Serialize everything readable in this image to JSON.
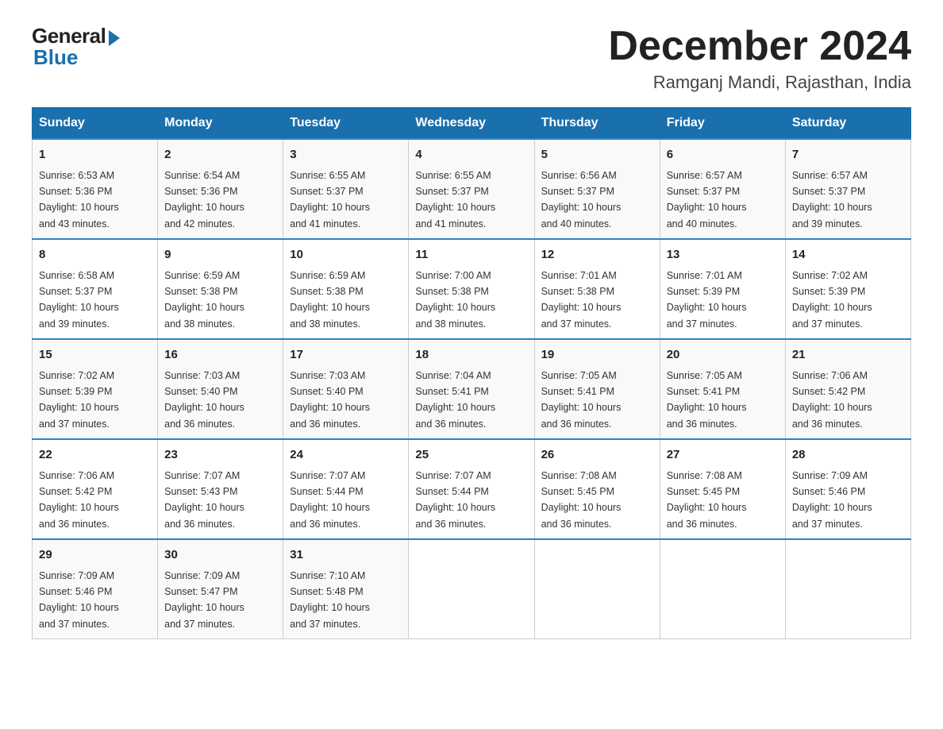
{
  "header": {
    "logo_general": "General",
    "logo_blue": "Blue",
    "title": "December 2024",
    "subtitle": "Ramganj Mandi, Rajasthan, India"
  },
  "weekdays": [
    "Sunday",
    "Monday",
    "Tuesday",
    "Wednesday",
    "Thursday",
    "Friday",
    "Saturday"
  ],
  "weeks": [
    [
      {
        "day": "1",
        "sunrise": "6:53 AM",
        "sunset": "5:36 PM",
        "daylight": "10 hours and 43 minutes."
      },
      {
        "day": "2",
        "sunrise": "6:54 AM",
        "sunset": "5:36 PM",
        "daylight": "10 hours and 42 minutes."
      },
      {
        "day": "3",
        "sunrise": "6:55 AM",
        "sunset": "5:37 PM",
        "daylight": "10 hours and 41 minutes."
      },
      {
        "day": "4",
        "sunrise": "6:55 AM",
        "sunset": "5:37 PM",
        "daylight": "10 hours and 41 minutes."
      },
      {
        "day": "5",
        "sunrise": "6:56 AM",
        "sunset": "5:37 PM",
        "daylight": "10 hours and 40 minutes."
      },
      {
        "day": "6",
        "sunrise": "6:57 AM",
        "sunset": "5:37 PM",
        "daylight": "10 hours and 40 minutes."
      },
      {
        "day": "7",
        "sunrise": "6:57 AM",
        "sunset": "5:37 PM",
        "daylight": "10 hours and 39 minutes."
      }
    ],
    [
      {
        "day": "8",
        "sunrise": "6:58 AM",
        "sunset": "5:37 PM",
        "daylight": "10 hours and 39 minutes."
      },
      {
        "day": "9",
        "sunrise": "6:59 AM",
        "sunset": "5:38 PM",
        "daylight": "10 hours and 38 minutes."
      },
      {
        "day": "10",
        "sunrise": "6:59 AM",
        "sunset": "5:38 PM",
        "daylight": "10 hours and 38 minutes."
      },
      {
        "day": "11",
        "sunrise": "7:00 AM",
        "sunset": "5:38 PM",
        "daylight": "10 hours and 38 minutes."
      },
      {
        "day": "12",
        "sunrise": "7:01 AM",
        "sunset": "5:38 PM",
        "daylight": "10 hours and 37 minutes."
      },
      {
        "day": "13",
        "sunrise": "7:01 AM",
        "sunset": "5:39 PM",
        "daylight": "10 hours and 37 minutes."
      },
      {
        "day": "14",
        "sunrise": "7:02 AM",
        "sunset": "5:39 PM",
        "daylight": "10 hours and 37 minutes."
      }
    ],
    [
      {
        "day": "15",
        "sunrise": "7:02 AM",
        "sunset": "5:39 PM",
        "daylight": "10 hours and 37 minutes."
      },
      {
        "day": "16",
        "sunrise": "7:03 AM",
        "sunset": "5:40 PM",
        "daylight": "10 hours and 36 minutes."
      },
      {
        "day": "17",
        "sunrise": "7:03 AM",
        "sunset": "5:40 PM",
        "daylight": "10 hours and 36 minutes."
      },
      {
        "day": "18",
        "sunrise": "7:04 AM",
        "sunset": "5:41 PM",
        "daylight": "10 hours and 36 minutes."
      },
      {
        "day": "19",
        "sunrise": "7:05 AM",
        "sunset": "5:41 PM",
        "daylight": "10 hours and 36 minutes."
      },
      {
        "day": "20",
        "sunrise": "7:05 AM",
        "sunset": "5:41 PM",
        "daylight": "10 hours and 36 minutes."
      },
      {
        "day": "21",
        "sunrise": "7:06 AM",
        "sunset": "5:42 PM",
        "daylight": "10 hours and 36 minutes."
      }
    ],
    [
      {
        "day": "22",
        "sunrise": "7:06 AM",
        "sunset": "5:42 PM",
        "daylight": "10 hours and 36 minutes."
      },
      {
        "day": "23",
        "sunrise": "7:07 AM",
        "sunset": "5:43 PM",
        "daylight": "10 hours and 36 minutes."
      },
      {
        "day": "24",
        "sunrise": "7:07 AM",
        "sunset": "5:44 PM",
        "daylight": "10 hours and 36 minutes."
      },
      {
        "day": "25",
        "sunrise": "7:07 AM",
        "sunset": "5:44 PM",
        "daylight": "10 hours and 36 minutes."
      },
      {
        "day": "26",
        "sunrise": "7:08 AM",
        "sunset": "5:45 PM",
        "daylight": "10 hours and 36 minutes."
      },
      {
        "day": "27",
        "sunrise": "7:08 AM",
        "sunset": "5:45 PM",
        "daylight": "10 hours and 36 minutes."
      },
      {
        "day": "28",
        "sunrise": "7:09 AM",
        "sunset": "5:46 PM",
        "daylight": "10 hours and 37 minutes."
      }
    ],
    [
      {
        "day": "29",
        "sunrise": "7:09 AM",
        "sunset": "5:46 PM",
        "daylight": "10 hours and 37 minutes."
      },
      {
        "day": "30",
        "sunrise": "7:09 AM",
        "sunset": "5:47 PM",
        "daylight": "10 hours and 37 minutes."
      },
      {
        "day": "31",
        "sunrise": "7:10 AM",
        "sunset": "5:48 PM",
        "daylight": "10 hours and 37 minutes."
      },
      null,
      null,
      null,
      null
    ]
  ],
  "labels": {
    "sunrise": "Sunrise:",
    "sunset": "Sunset:",
    "daylight": "Daylight:"
  }
}
